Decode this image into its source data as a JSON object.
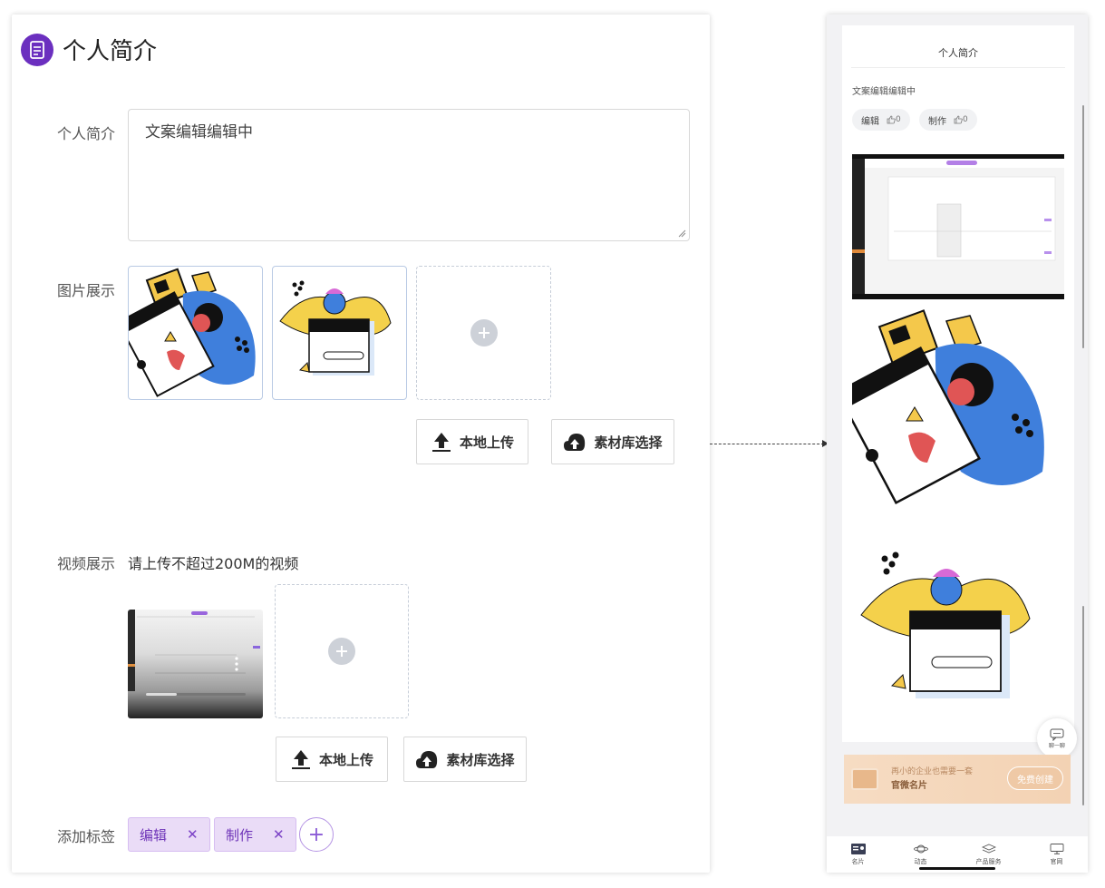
{
  "editor": {
    "title": "个人简介",
    "intro_label": "个人简介",
    "intro_value": "文案编辑编辑中",
    "images_label": "图片展示",
    "upload_local": "本地上传",
    "library_select": "素材库选择",
    "video_label": "视频展示",
    "video_hint": "请上传不超过200M的视频",
    "video_upload_local": "本地上传",
    "video_library_select": "素材库选择",
    "tags_label": "添加标签",
    "tags": [
      "编辑",
      "制作"
    ],
    "accent_color": "#6b2fbf"
  },
  "preview": {
    "title": "个人简介",
    "text": "文案编辑编辑中",
    "chips": [
      {
        "label": "编辑",
        "likes": "0"
      },
      {
        "label": "制作",
        "likes": "0"
      }
    ],
    "chat_label": "聊一聊",
    "promo_line1": "再小的企业也需要一套",
    "promo_line2": "官微名片",
    "promo_button": "免费创建",
    "tabs": [
      "名片",
      "动态",
      "产品服务",
      "官网"
    ]
  }
}
